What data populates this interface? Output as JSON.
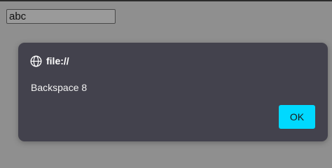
{
  "page": {
    "input_value": "abc"
  },
  "dialog": {
    "origin": "file://",
    "message": "Backspace 8",
    "ok_label": "OK",
    "origin_icon": "globe-icon"
  },
  "colors": {
    "overlay_background": "#8f8f8f",
    "dialog_background": "#43424d",
    "ok_button": "#00d9ff"
  }
}
